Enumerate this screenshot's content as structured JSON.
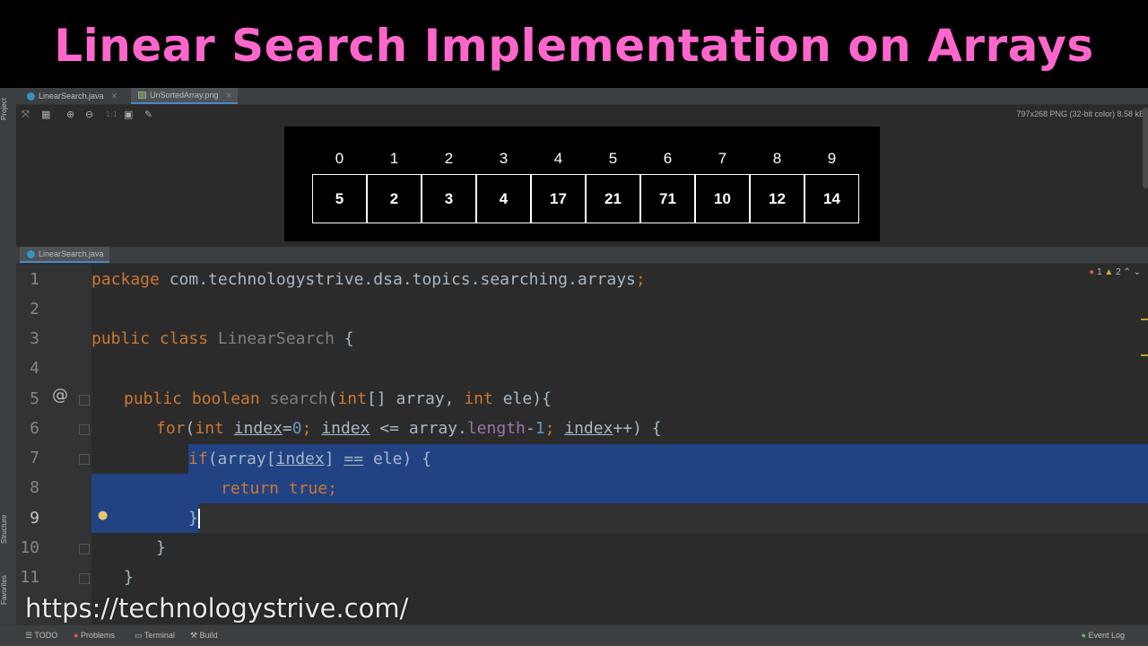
{
  "banner": {
    "title": "Linear Search Implementation on Arrays"
  },
  "side_panels": {
    "project": "Project",
    "structure": "Structure",
    "favorites": "Favorites"
  },
  "top_tabs": [
    {
      "label": "LinearSearch.java"
    },
    {
      "label": "UnSortedArray.png"
    }
  ],
  "image_viewer": {
    "info": "797x268 PNG (32-bit color) 8.58 kB",
    "indices": [
      "0",
      "1",
      "2",
      "3",
      "4",
      "5",
      "6",
      "7",
      "8",
      "9"
    ],
    "values": [
      "5",
      "2",
      "3",
      "4",
      "17",
      "21",
      "71",
      "10",
      "12",
      "14"
    ]
  },
  "editor_tab": {
    "label": "LinearSearch.java"
  },
  "inspections": {
    "errors": "1",
    "warnings": "2"
  },
  "code": {
    "line_numbers": [
      "1",
      "2",
      "3",
      "4",
      "5",
      "6",
      "7",
      "8",
      "9",
      "10",
      "11"
    ],
    "l1_kw": "package",
    "l1_rest": " com.technologystrive.dsa.topics.searching.arrays",
    "l1_semi": ";",
    "l3_kw1": "public",
    "l3_kw2": "class",
    "l3_name": "LinearSearch",
    "l3_brace": "{",
    "l5_kw1": "public",
    "l5_kw2": "boolean",
    "l5_method": "search",
    "l5_p1": "(",
    "l5_int1": "int",
    "l5_p2": "[] array, ",
    "l5_int2": "int",
    "l5_p3": " ele){",
    "l6_for": "for",
    "l6_p1": "(",
    "l6_int": "int",
    "l6_idx1": "index",
    "l6_eq": "=",
    "l6_zero": "0",
    "l6_semi1": "; ",
    "l6_idx2": "index",
    "l6_le": " <= array.",
    "l6_length": "length",
    "l6_minus": "-",
    "l6_one": "1",
    "l6_semi2": "; ",
    "l6_idx3": "index",
    "l6_end": "++) {",
    "l7_if": "if",
    "l7_p1": "(array[",
    "l7_idx": "index",
    "l7_p2": "] ",
    "l7_eqeq": "==",
    "l7_p3": " ele) {",
    "l8_return": "return",
    "l8_true": "true",
    "l8_semi": ";",
    "l9_brace": "}",
    "l10_brace": "}",
    "l11_brace": "}"
  },
  "watermark_url": "https://technologystrive.com/",
  "status_bar": {
    "todo": "TODO",
    "problems": "Problems",
    "terminal": "Terminal",
    "build": "Build",
    "event_log": "Event Log"
  }
}
